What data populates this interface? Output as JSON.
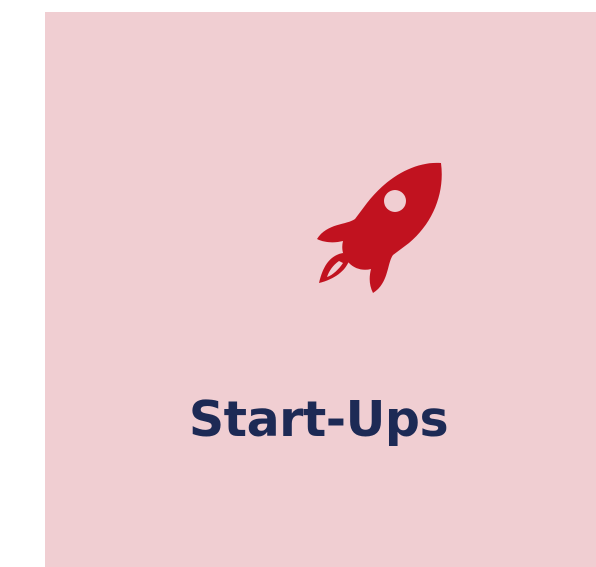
{
  "tile": {
    "label": "Start-Ups",
    "icon": "rocket-icon",
    "background_color": "#f0ced2",
    "icon_color": "#c1121f",
    "text_color": "#1d2a55"
  }
}
